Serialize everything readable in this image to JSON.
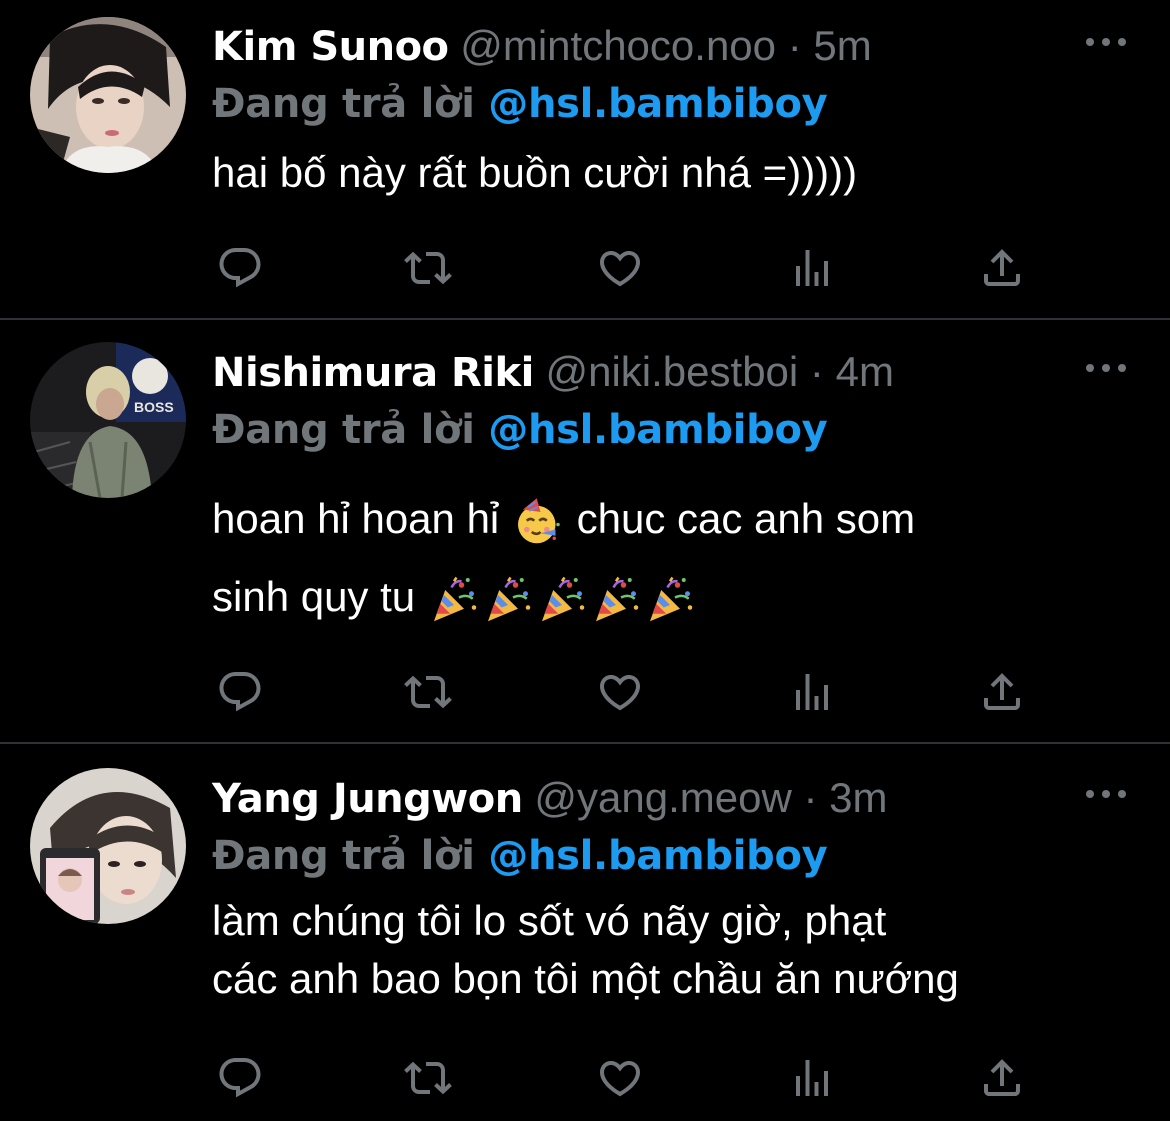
{
  "reply_prefix": "Đang trả lời",
  "tweets": [
    {
      "name": "Kim Sunoo",
      "handle": "@mintchoco.noo",
      "separator": "·",
      "time": "5m",
      "replying_to": "@hsl.bambiboy",
      "text_lines": [
        "hai bố này rất buồn cười nhá =)))))"
      ]
    },
    {
      "name": "Nishimura Riki",
      "handle": "@niki.bestboi",
      "separator": "·",
      "time": "4m",
      "replying_to": "@hsl.bambiboy",
      "text_line1_a": "hoan hỉ hoan hỉ",
      "text_line1_b": "chuc cac anh som",
      "text_line2": "sinh quy tu",
      "emojis": [
        "partying-face-emoji",
        "party-popper-emoji"
      ]
    },
    {
      "name": "Yang Jungwon",
      "handle": "@yang.meow",
      "separator": "·",
      "time": "3m",
      "replying_to": "@hsl.bambiboy",
      "text_lines": [
        "làm chúng tôi lo sốt vó nãy giờ, phạt",
        "các anh bao bọn tôi một chầu ăn nướng"
      ]
    }
  ],
  "action_icons": [
    "reply-icon",
    "retweet-icon",
    "like-icon",
    "views-icon",
    "share-icon"
  ],
  "colors": {
    "background": "#000000",
    "name": "#ffffff",
    "secondary": "#71767b",
    "mention": "#1d9bf0",
    "divider": "#2f3336"
  }
}
